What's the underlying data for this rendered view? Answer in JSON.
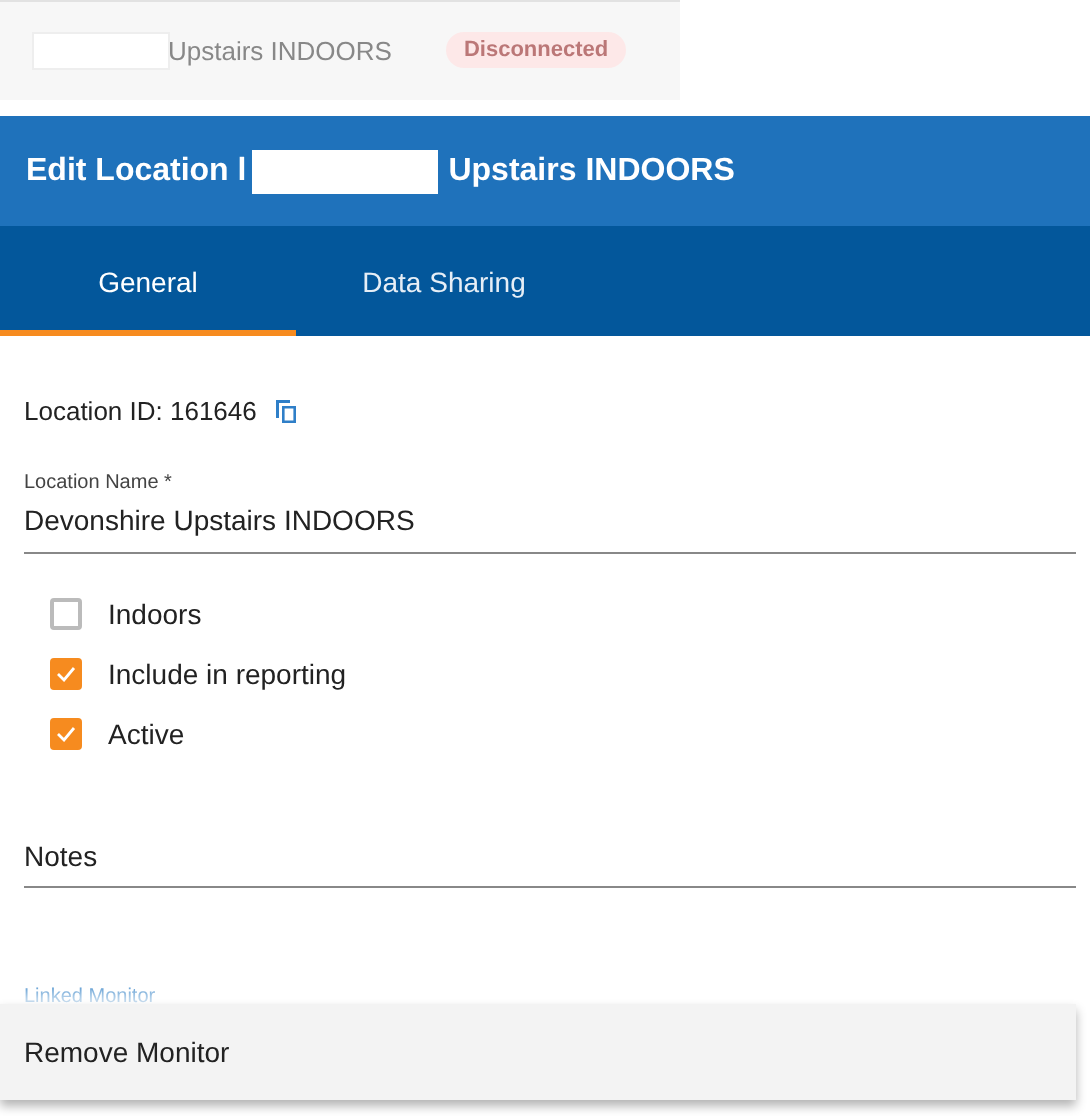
{
  "list_row": {
    "name": "Upstairs INDOORS",
    "status": "Disconnected",
    "redacted": true
  },
  "dialog": {
    "title_prefix": "Edit Location l",
    "title_suffix": "Upstairs INDOORS",
    "redacted": true
  },
  "tabs": [
    {
      "label": "General",
      "selected": true
    },
    {
      "label": "Data Sharing",
      "selected": false
    }
  ],
  "location_id": "Location ID: 161646",
  "location_name": {
    "label": "Location Name",
    "required_mark": "*",
    "value": "Devonshire Upstairs INDOORS"
  },
  "checkboxes": [
    {
      "label": "Indoors",
      "checked": false
    },
    {
      "label": "Include in reporting",
      "checked": true
    },
    {
      "label": "Active",
      "checked": true
    }
  ],
  "notes": {
    "placeholder": "Notes"
  },
  "linked_monitor_label": "Linked Monitor",
  "menu": {
    "items": [
      "Remove Monitor"
    ]
  }
}
